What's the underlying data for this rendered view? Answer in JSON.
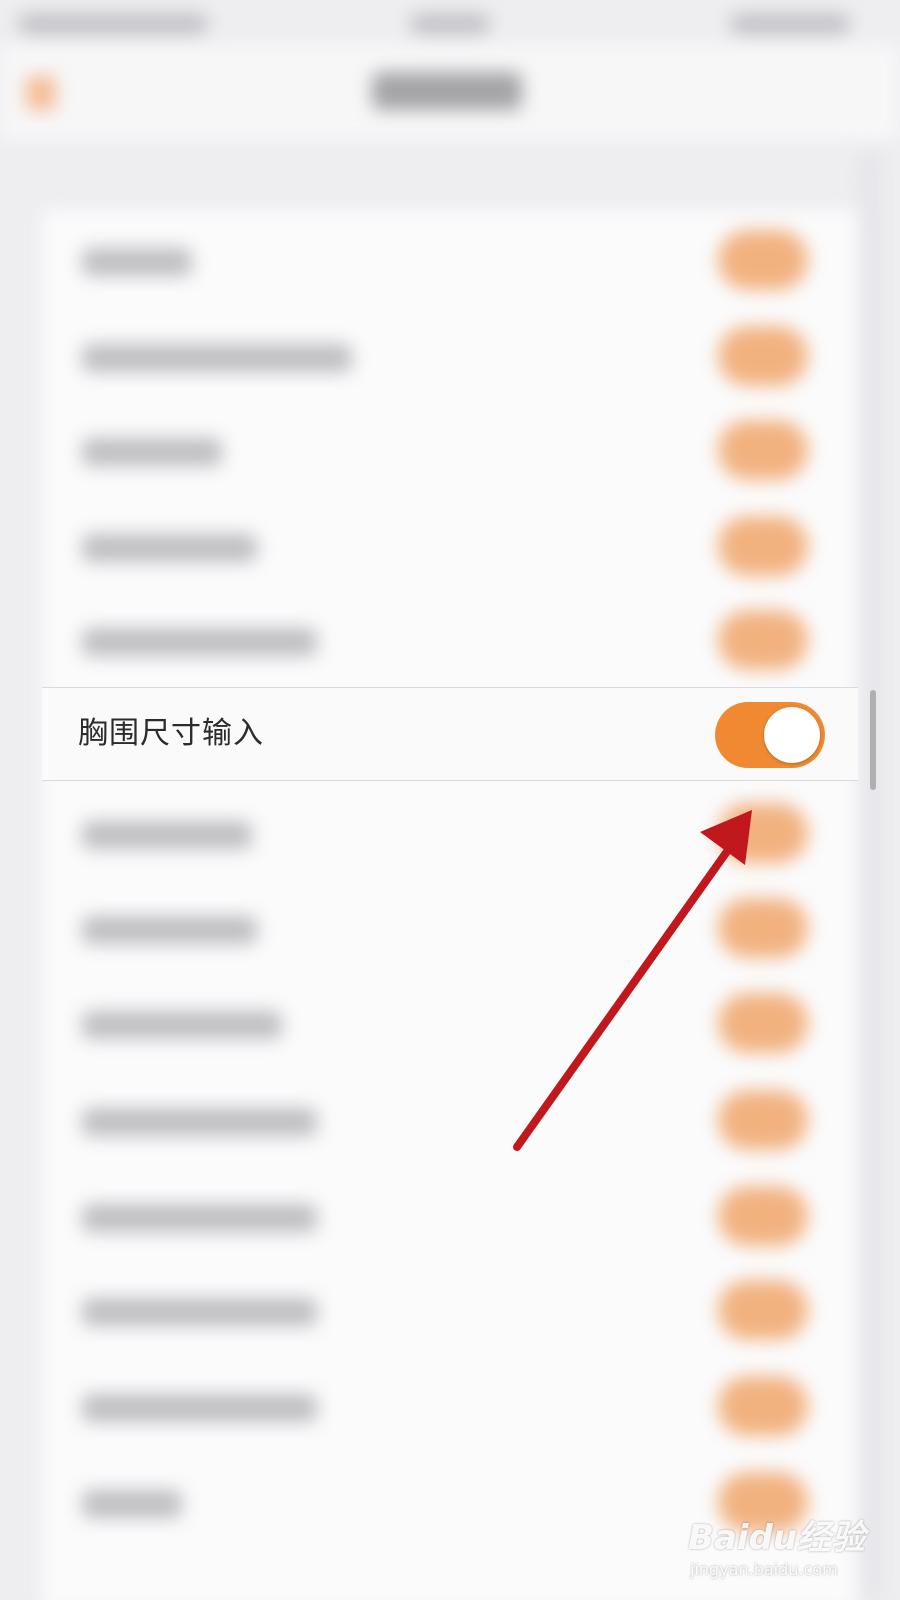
{
  "focused_row": {
    "label": "胸围尺寸输入",
    "toggle_on": true
  },
  "colors": {
    "accent": "#ef8a33",
    "annotation_arrow": "#c0181c",
    "background": "#eeeef1"
  },
  "annotation": {
    "icon": "arrow-icon"
  },
  "watermark": {
    "logo_text": "Baidu经验",
    "url": "jingyan.baidu.com"
  }
}
